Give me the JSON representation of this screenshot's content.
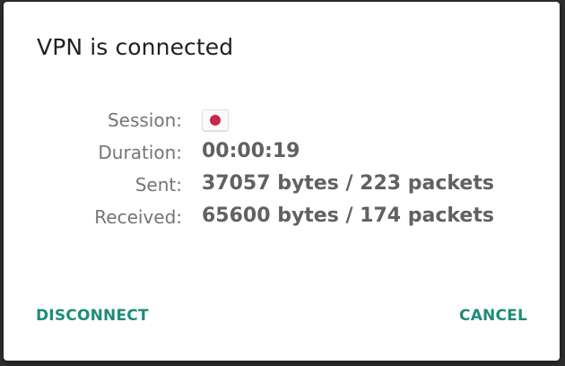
{
  "dialog": {
    "title": "VPN is connected",
    "rows": [
      {
        "label": "Session:",
        "value": "",
        "flag_icon": "japan-flag-icon"
      },
      {
        "label": "Duration:",
        "value": "00:00:19"
      },
      {
        "label": "Sent:",
        "value": "37057 bytes / 223 packets"
      },
      {
        "label": "Received:",
        "value": "65600 bytes / 174 packets"
      }
    ],
    "actions": {
      "disconnect": "DISCONNECT",
      "cancel": "CANCEL"
    }
  },
  "colors": {
    "accent": "#1e8c7a",
    "title": "#212121",
    "label": "#757575",
    "value": "#616161",
    "flag_red": "#c62847"
  }
}
